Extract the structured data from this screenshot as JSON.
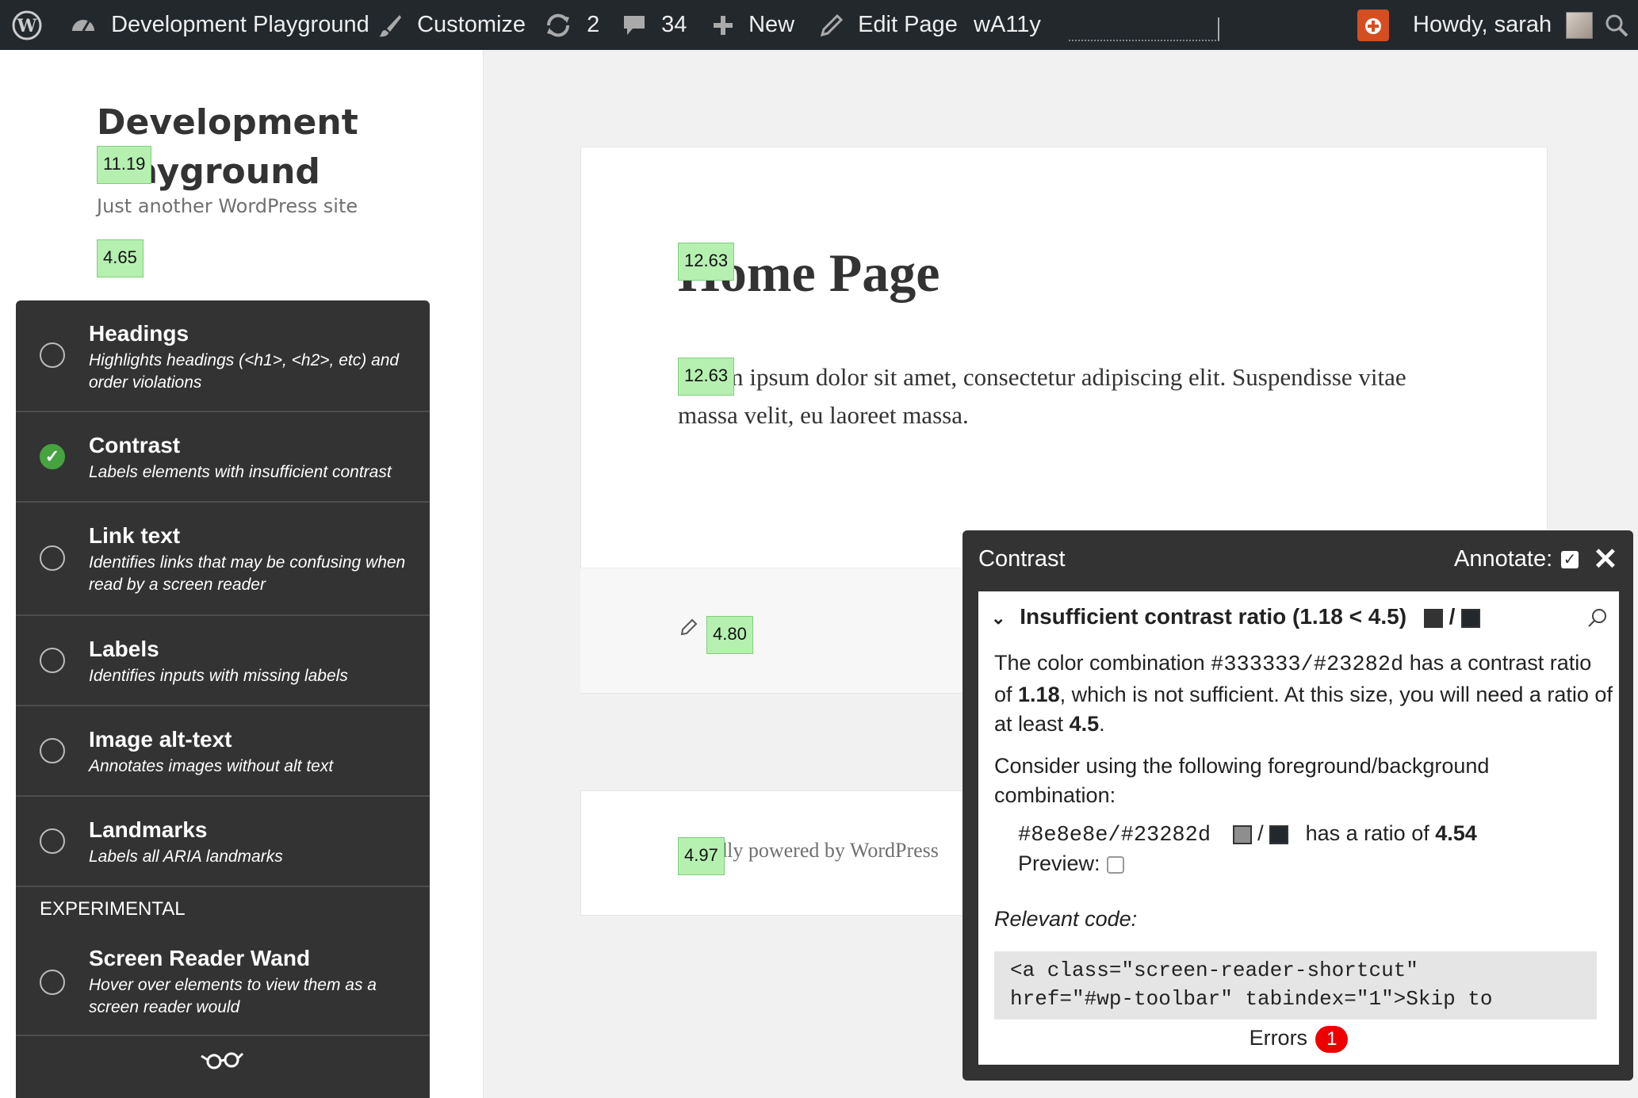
{
  "adminbar": {
    "site_name": "Development Playground",
    "customize": "Customize",
    "updates_count": "2",
    "comments_count": "34",
    "new_label": "New",
    "edit_page": "Edit Page",
    "plugin": "wA11y",
    "howdy": "Howdy, sarah"
  },
  "site": {
    "title": "Development Playground",
    "description": "Just another WordPress site"
  },
  "badges": {
    "site_title": "11.19",
    "site_desc": "4.65",
    "post_title": "12.63",
    "post_body": "12.63",
    "edit_link": "4.80",
    "footer": "4.97"
  },
  "tools": {
    "items": [
      {
        "name": "Headings",
        "desc": "Highlights headings (<h1>, <h2>, etc) and order violations",
        "active": false
      },
      {
        "name": "Contrast",
        "desc": "Labels elements with insufficient contrast",
        "active": true
      },
      {
        "name": "Link text",
        "desc": "Identifies links that may be confusing when read by a screen reader",
        "active": false
      },
      {
        "name": "Labels",
        "desc": "Identifies inputs with missing labels",
        "active": false
      },
      {
        "name": "Image alt-text",
        "desc": "Annotates images without alt text",
        "active": false
      },
      {
        "name": "Landmarks",
        "desc": "Labels all ARIA landmarks",
        "active": false
      }
    ],
    "experimental_heading": "EXPERIMENTAL",
    "experimental": {
      "name": "Screen Reader Wand",
      "desc": "Hover over elements to view them as a screen reader would"
    }
  },
  "post": {
    "title": "Home Page",
    "body": "Lorem ipsum dolor sit amet, consectetur adipiscing elit. Suspendisse vitae massa velit, eu laoreet massa."
  },
  "footer": {
    "text": "Proudly powered by WordPress"
  },
  "panel": {
    "title": "Contrast",
    "annotate_label": "Annotate:",
    "issue_title": "Insufficient contrast ratio (1.18 < 4.5)",
    "fg_color": "#333333",
    "bg_color": "#23282d",
    "msg_pre": "The color combination ",
    "msg_colors": "#333333/#23282d",
    "msg_mid": " has a contrast ratio of ",
    "msg_ratio": "1.18",
    "msg_mid2": ", which is not sufficient. At this size, you will need a ratio of at least ",
    "msg_min": "4.5",
    "msg_end": ".",
    "consider": "Consider using the following foreground/background combination:",
    "suggest_colors": "#8e8e8e/#23282d",
    "suggest_fg": "#8e8e8e",
    "suggest_pre": "has a ratio of ",
    "suggest_ratio": "4.54",
    "preview_label": "Preview:",
    "relevant_label": "Relevant code:",
    "code": "<a class=\"screen-reader-shortcut\"\nhref=\"#wp-toolbar\" tabindex=\"1\">Skip to",
    "errors_label": "Errors",
    "errors_count": "1"
  },
  "colors": {
    "adminbar_bg": "#23282d",
    "panel_bg": "#333333",
    "badge_bg": "#b6f0b1",
    "active_green": "#46a340",
    "error_red": "#ee0000",
    "notify_orange": "#d54e21"
  }
}
